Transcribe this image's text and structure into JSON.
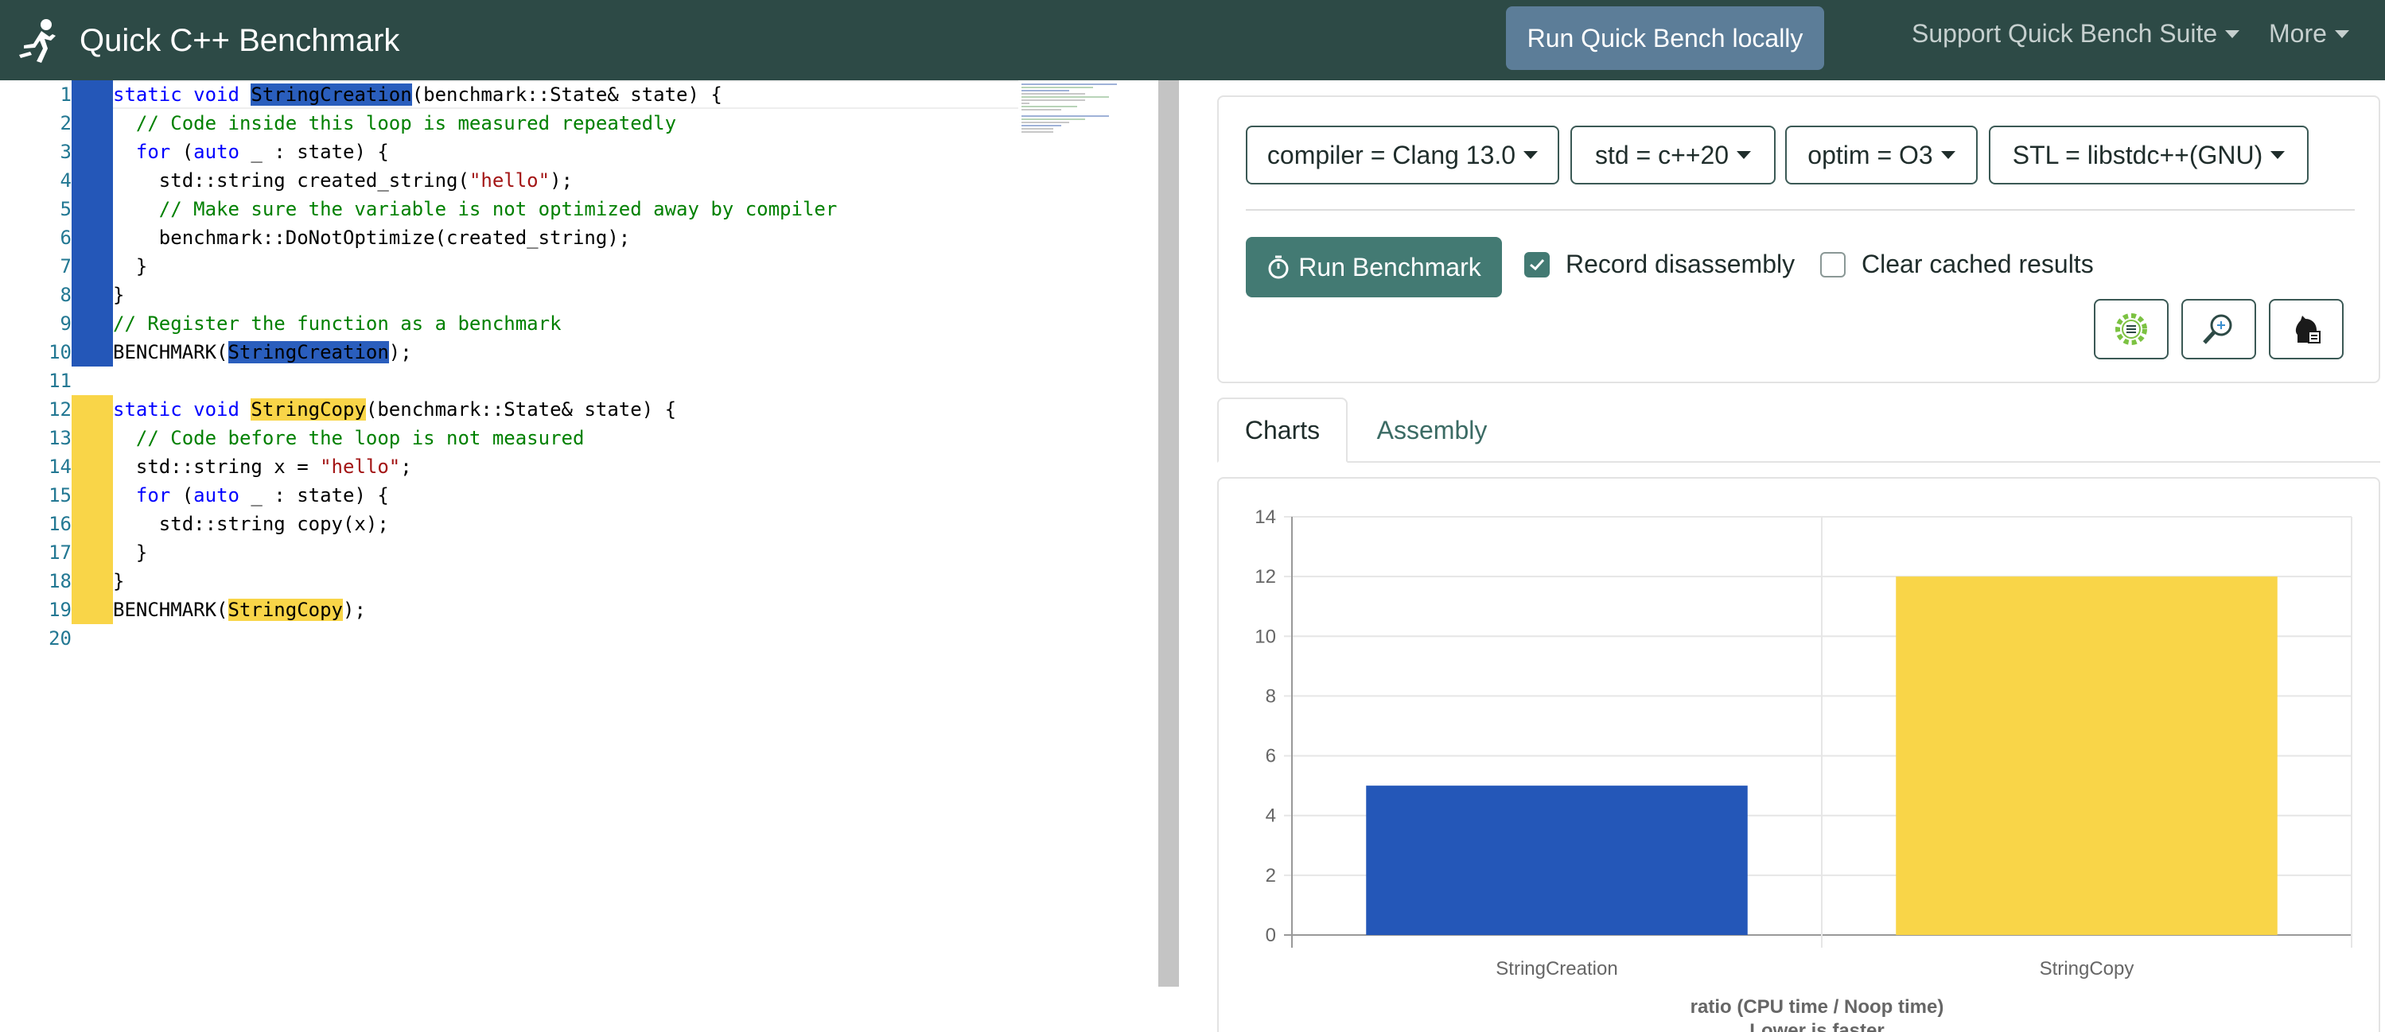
{
  "navbar": {
    "title": "Quick C++ Benchmark",
    "run_local_label": "Run Quick Bench locally",
    "support_label": "Support Quick Bench Suite",
    "more_label": "More",
    "bg_color": "#2d4a46"
  },
  "editor": {
    "lines": [
      {
        "n": "1"
      },
      {
        "n": "2"
      },
      {
        "n": "3"
      },
      {
        "n": "4"
      },
      {
        "n": "5"
      },
      {
        "n": "6"
      },
      {
        "n": "7"
      },
      {
        "n": "8"
      },
      {
        "n": "9"
      },
      {
        "n": "10"
      },
      {
        "n": "11"
      },
      {
        "n": "12"
      },
      {
        "n": "13"
      },
      {
        "n": "14"
      },
      {
        "n": "15"
      },
      {
        "n": "16"
      },
      {
        "n": "17"
      },
      {
        "n": "18"
      },
      {
        "n": "19"
      },
      {
        "n": "20"
      }
    ],
    "tokens": {
      "static_void": "static void",
      "fn1": "StringCreation",
      "sig_rest": "(benchmark::State& state) {",
      "c1": "// Code inside this loop is measured repeatedly",
      "for": "for",
      "open_paren": " (",
      "auto": "auto",
      "for_rest": " _ : state) {",
      "l4a": "std::string created_string(",
      "hello_q": "\"hello\"",
      "l4b": ");",
      "c2": "// Make sure the variable is not optimized away by compiler",
      "l6": "benchmark::DoNotOptimize(created_string);",
      "close": "}",
      "c3": "// Register the function as a benchmark",
      "bm_open": "BENCHMARK(",
      "bm_close": ");",
      "fn2": "StringCopy",
      "c4": "// Code before the loop is not measured",
      "l14a": "std::string x = ",
      "semi": ";",
      "l16": "std::string copy(x);"
    }
  },
  "controls": {
    "compiler": "compiler = Clang 13.0",
    "std": "std = c++20",
    "optim": "optim = O3",
    "stl": "STL = libstdc++(GNU)",
    "run_label": "Run Benchmark",
    "record_label": "Record disassembly",
    "record_checked": true,
    "clear_label": "Clear cached results",
    "clear_checked": false,
    "tool_icons": [
      "gear-list-icon",
      "zoom-icon",
      "chess-knight-icon"
    ]
  },
  "tabs": {
    "charts": "Charts",
    "assembly": "Assembly"
  },
  "chart_data": {
    "type": "bar",
    "categories": [
      "StringCreation",
      "StringCopy"
    ],
    "values": [
      5,
      12
    ],
    "colors": [
      "#2457b8",
      "#f9d548"
    ],
    "ylim": [
      0,
      14
    ],
    "yticks": [
      "0",
      "2",
      "4",
      "6",
      "8",
      "10",
      "12",
      "14"
    ],
    "xlabel": "ratio (CPU time / Noop time)",
    "xlabel2": "Lower is faster",
    "grid": true
  }
}
